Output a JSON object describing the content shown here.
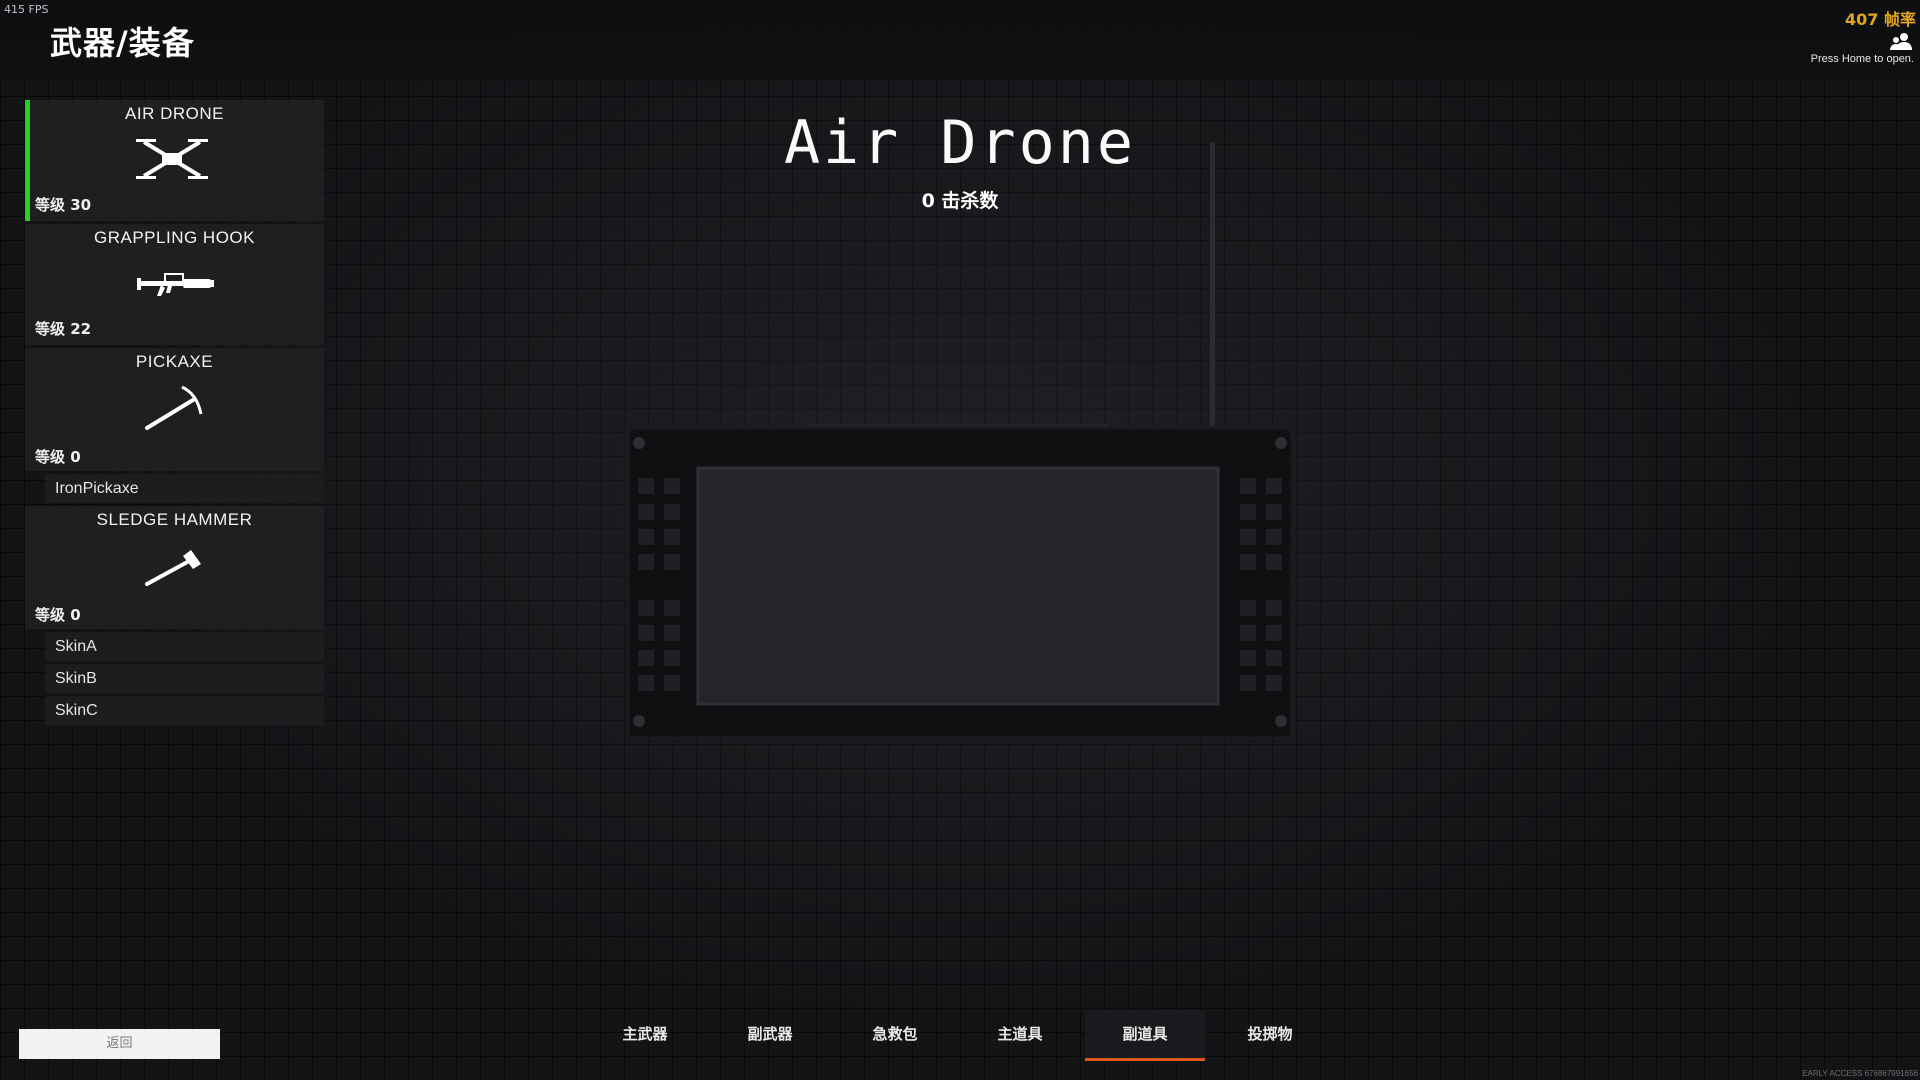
{
  "hud": {
    "fps_small": "415 FPS",
    "fps_right": "407 帧率",
    "press_home": "Press Home to open.",
    "friends_icon": "friends-icon",
    "build_info": "EARLY ACCESS 676867991656"
  },
  "header": {
    "title": "武器/装备"
  },
  "items": [
    {
      "name": "AIR DRONE",
      "level": "等级 30",
      "icon": "drone-icon",
      "selected": true
    },
    {
      "name": "GRAPPLING HOOK",
      "level": "等级 22",
      "icon": "grappling-hook-icon"
    },
    {
      "name": "PICKAXE",
      "level": "等级 0",
      "icon": "pickaxe-icon",
      "skins": [
        "IronPickaxe"
      ]
    },
    {
      "name": "SLEDGE HAMMER",
      "level": "等级 0",
      "icon": "sledge-hammer-icon",
      "skins": [
        "SkinA",
        "SkinB",
        "SkinC"
      ]
    }
  ],
  "detail": {
    "name": "Air Drone",
    "kills": "0 击杀数"
  },
  "tabs": [
    {
      "label": "主武器"
    },
    {
      "label": "副武器"
    },
    {
      "label": "急救包"
    },
    {
      "label": "主道具"
    },
    {
      "label": "副道具",
      "active": true
    },
    {
      "label": "投掷物"
    }
  ],
  "footer": {
    "back_label": "返回"
  },
  "colors": {
    "selected_accent": "#27d023",
    "tab_accent": "#d9581f",
    "fps_text": "#e3a620"
  }
}
